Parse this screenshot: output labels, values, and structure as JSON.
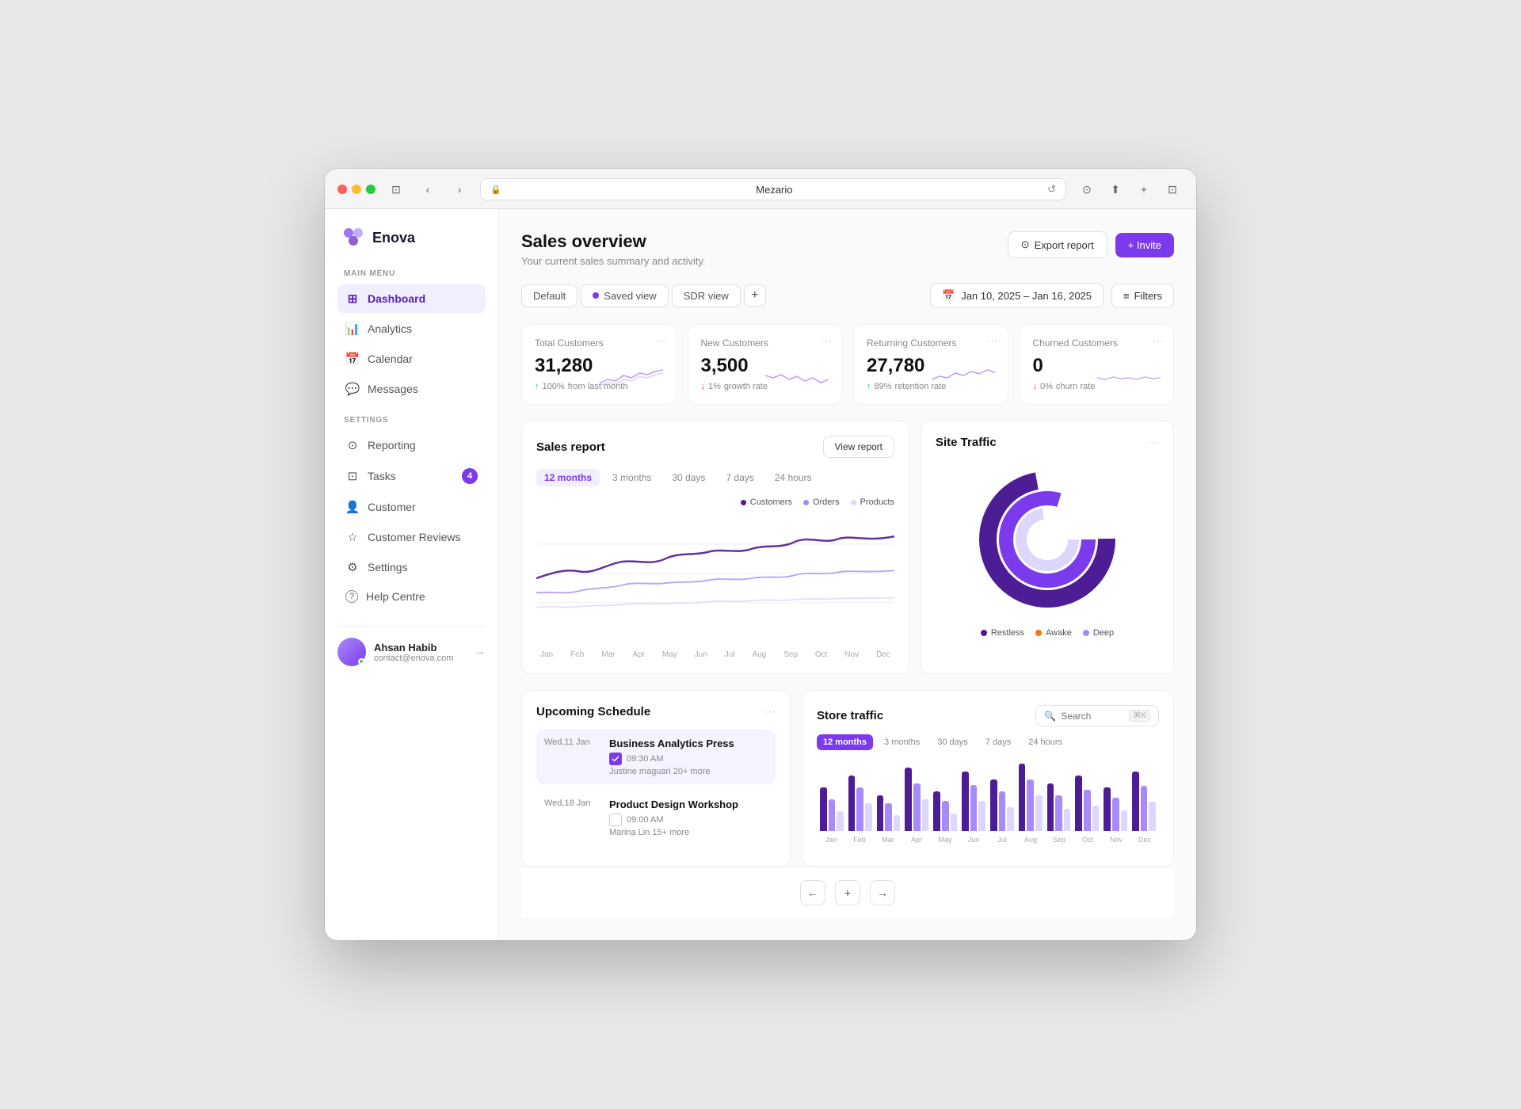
{
  "browser": {
    "url": "Mezario",
    "url_icon": "🔒"
  },
  "sidebar": {
    "logo_text": "Enova",
    "main_menu_label": "MAIN MENU",
    "settings_label": "SETTINGS",
    "main_items": [
      {
        "id": "dashboard",
        "label": "Dashboard",
        "icon": "⊞",
        "active": true
      },
      {
        "id": "analytics",
        "label": "Analytics",
        "icon": "📊",
        "active": false
      },
      {
        "id": "calendar",
        "label": "Calendar",
        "icon": "📅",
        "active": false
      },
      {
        "id": "messages",
        "label": "Messages",
        "icon": "💬",
        "active": false
      }
    ],
    "settings_items": [
      {
        "id": "reporting",
        "label": "Reporting",
        "icon": "⊙",
        "badge": null,
        "active": false
      },
      {
        "id": "tasks",
        "label": "Tasks",
        "icon": "⊡",
        "badge": "4",
        "active": false
      },
      {
        "id": "customer",
        "label": "Customer",
        "icon": "👤",
        "badge": null,
        "active": false
      },
      {
        "id": "customer-reviews",
        "label": "Customer Reviews",
        "icon": "☆",
        "badge": null,
        "active": false
      },
      {
        "id": "settings",
        "label": "Settings",
        "icon": "⚙",
        "badge": null,
        "active": false
      },
      {
        "id": "help-centre",
        "label": "Help Centre",
        "icon": "?",
        "badge": null,
        "active": false
      }
    ],
    "user": {
      "name": "Ahsan Habib",
      "email": "contact@enova.com"
    }
  },
  "page": {
    "title": "Sales overview",
    "subtitle": "Your current sales summary and activity.",
    "export_label": "Export report",
    "invite_label": "+ Invite"
  },
  "toolbar": {
    "views": [
      "Default",
      "Saved view",
      "SDR view"
    ],
    "date_range": "Jan 10, 2025 – Jan 16, 2025",
    "filters_label": "Filters"
  },
  "metrics": [
    {
      "label": "Total Customers",
      "value": "31,280",
      "trend": "up",
      "trend_value": "100%",
      "trend_label": "from last month"
    },
    {
      "label": "New Customers",
      "value": "3,500",
      "trend": "down",
      "trend_value": "1%",
      "trend_label": "growth rate"
    },
    {
      "label": "Returning Customers",
      "value": "27,780",
      "trend": "up",
      "trend_value": "89%",
      "trend_label": "retention rate"
    },
    {
      "label": "Churned Customers",
      "value": "0",
      "trend": "down",
      "trend_value": "0%",
      "trend_label": "churn rate"
    }
  ],
  "sales_report": {
    "title": "Sales report",
    "view_report_label": "View report",
    "tabs": [
      "12 months",
      "3 months",
      "30 days",
      "7 days",
      "24 hours"
    ],
    "active_tab": "12 months",
    "legend": [
      "Customers",
      "Orders",
      "Products"
    ],
    "x_labels": [
      "Jan",
      "Feb",
      "Mar",
      "Apr",
      "May",
      "Jun",
      "Jul",
      "Aug",
      "Sep",
      "Oct",
      "Nov",
      "Dec"
    ]
  },
  "site_traffic": {
    "title": "Site Traffic",
    "legend": [
      {
        "label": "Restless",
        "color": "#4c1d95"
      },
      {
        "label": "Awake",
        "color": "#f97316"
      },
      {
        "label": "Deep",
        "color": "#a78bfa"
      }
    ]
  },
  "upcoming_schedule": {
    "title": "Upcoming Schedule",
    "items": [
      {
        "date": "Wed,11 Jan",
        "time": "09:30 AM",
        "name": "Business Analytics Press",
        "sub": "Justine maguari 20+ more",
        "checked": true,
        "highlighted": true
      },
      {
        "date": "Wed,18 Jan",
        "time": "09:00 AM",
        "name": "Product Design Workshop",
        "sub": "Marina Lin 15+ more",
        "checked": false,
        "highlighted": false
      }
    ]
  },
  "store_traffic": {
    "title": "Store traffic",
    "search_placeholder": "Search",
    "search_shortcut": "⌘K",
    "tabs": [
      "12 months",
      "3 months",
      "30 days",
      "7 days",
      "24 hours"
    ],
    "active_tab": "12 months",
    "x_labels": [
      "Jan",
      "Feb",
      "Mar",
      "Apr",
      "May",
      "Jun",
      "Jul",
      "Aug",
      "Sep",
      "Oct",
      "Nov",
      "Dec"
    ],
    "bars": [
      {
        "dark": 55,
        "mid": 40,
        "light": 25
      },
      {
        "dark": 70,
        "mid": 55,
        "light": 35
      },
      {
        "dark": 45,
        "mid": 35,
        "light": 20
      },
      {
        "dark": 80,
        "mid": 60,
        "light": 40
      },
      {
        "dark": 50,
        "mid": 38,
        "light": 22
      },
      {
        "dark": 75,
        "mid": 58,
        "light": 38
      },
      {
        "dark": 65,
        "mid": 50,
        "light": 30
      },
      {
        "dark": 85,
        "mid": 65,
        "light": 45
      },
      {
        "dark": 60,
        "mid": 45,
        "light": 28
      },
      {
        "dark": 70,
        "mid": 52,
        "light": 32
      },
      {
        "dark": 55,
        "mid": 42,
        "light": 26
      },
      {
        "dark": 75,
        "mid": 57,
        "light": 37
      }
    ]
  },
  "nav_bottom": {
    "prev": "←",
    "add": "+",
    "next": "→"
  },
  "colors": {
    "primary": "#7c3aed",
    "primary_light": "#a78bfa",
    "primary_lighter": "#ddd6fe",
    "green": "#22c55e",
    "red": "#ef4444",
    "orange": "#f97316"
  }
}
